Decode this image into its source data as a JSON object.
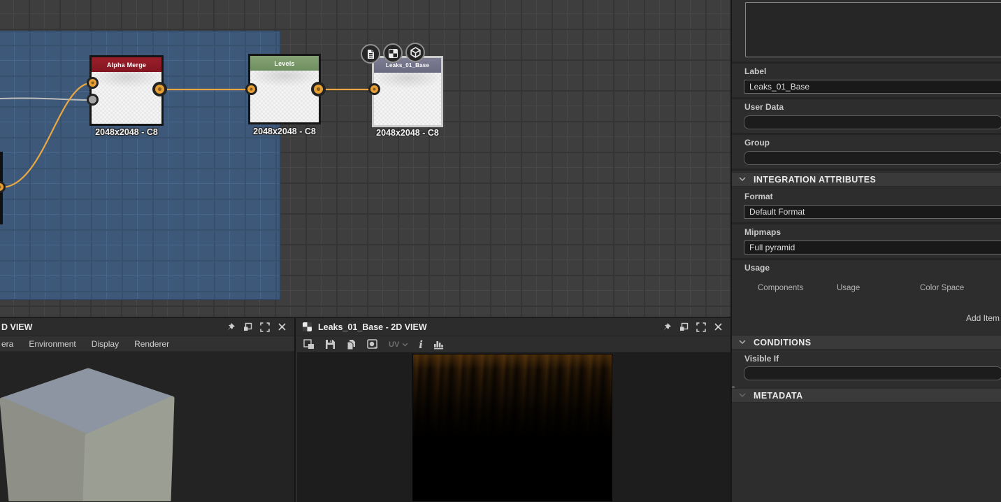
{
  "graph": {
    "nodes": [
      {
        "title": "Alpha Merge",
        "resolution": "2048x2048 - C8",
        "header_color": "#8e1c26"
      },
      {
        "title": "Levels",
        "resolution": "2048x2048 - C8",
        "header_color": "#7d9c6d"
      },
      {
        "title": "Leaks_01_Base",
        "resolution": "2048x2048 - C8",
        "header_color": "#73738a"
      }
    ],
    "wire_color": "#e8a743",
    "selection_color": "#3d5878"
  },
  "panel3d": {
    "title": "D VIEW",
    "menu": [
      {
        "label": "era"
      },
      {
        "label": "Environment"
      },
      {
        "label": "Display"
      },
      {
        "label": "Renderer"
      }
    ]
  },
  "panel2d": {
    "title": "Leaks_01_Base - 2D VIEW",
    "toolbar": {
      "uv_label": "UV",
      "info_glyph": "i"
    }
  },
  "properties": {
    "label": {
      "heading": "Label",
      "value": "Leaks_01_Base"
    },
    "user_data": {
      "heading": "User Data",
      "value": ""
    },
    "group": {
      "heading": "Group",
      "value": ""
    },
    "integration": {
      "title": "INTEGRATION ATTRIBUTES",
      "format": {
        "heading": "Format",
        "value": "Default Format"
      },
      "mipmaps": {
        "heading": "Mipmaps",
        "value": "Full pyramid"
      },
      "usage": {
        "heading": "Usage",
        "columns": [
          "Components",
          "Usage",
          "Color Space"
        ],
        "add_item": "Add Item"
      }
    },
    "conditions": {
      "title": "CONDITIONS",
      "visible_if": {
        "heading": "Visible If",
        "value": ""
      }
    },
    "metadata": {
      "title": "METADATA"
    }
  }
}
